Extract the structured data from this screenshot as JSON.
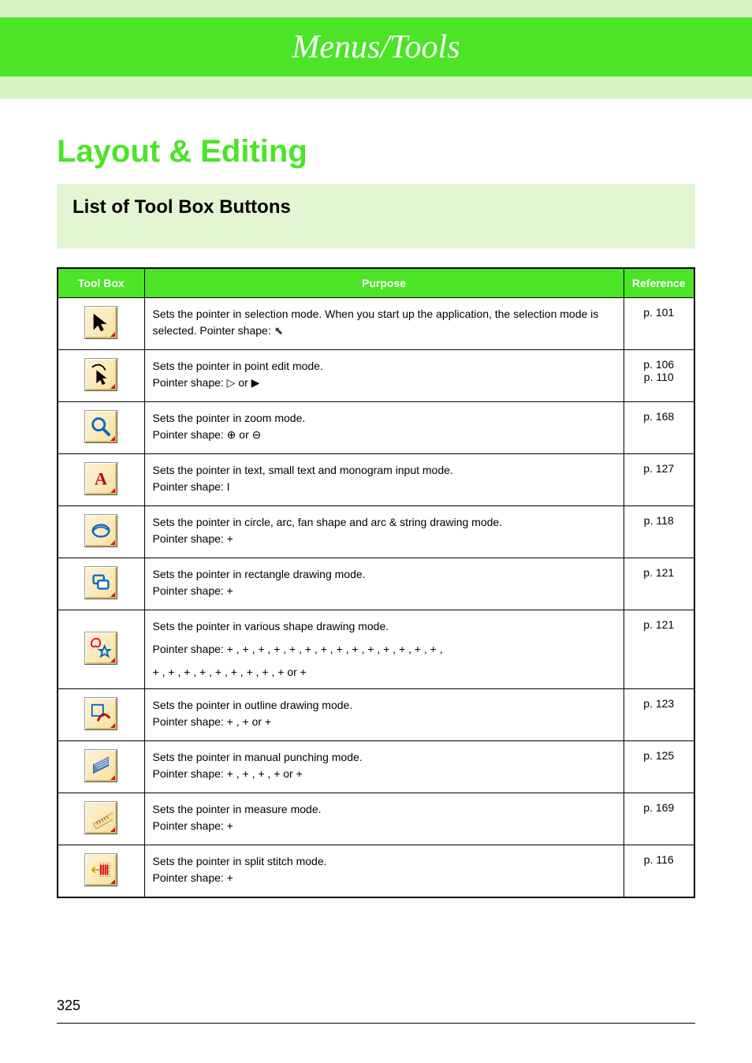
{
  "banner_title": "Menus/Tools",
  "section_title": "Layout & Editing",
  "subsection_title": "List of Tool Box Buttons",
  "table_headers": {
    "tool": "Tool Box",
    "purpose": "Purpose",
    "ref": "Reference"
  },
  "rows": [
    {
      "icon": "selection",
      "purpose_a": "Sets the pointer in selection mode. When you start up the application, the selection mode is selected. Pointer shape: ",
      "ref": "p. 101"
    },
    {
      "icon": "point-edit",
      "purpose_a": "Sets the pointer in point edit mode.",
      "purpose_b": "Pointer shape:  ▷  or  ▶",
      "ref": "p. 106\np. 110"
    },
    {
      "icon": "zoom",
      "purpose_a": "Sets the pointer in zoom mode.",
      "purpose_b": "Pointer shape:  ⊕  or  ⊖",
      "ref": "p. 168"
    },
    {
      "icon": "text",
      "purpose_a": "Sets the pointer in text, small text and monogram input mode.",
      "purpose_b": "Pointer shape:   I",
      "ref": "p. 127"
    },
    {
      "icon": "circle",
      "purpose_a": "Sets the pointer in circle, arc, fan shape and arc & string drawing mode.",
      "purpose_b": "Pointer shape:  +",
      "ref": "p. 118"
    },
    {
      "icon": "rect",
      "purpose_a": "Sets the pointer in rectangle drawing mode.",
      "purpose_b": "Pointer shape:  +",
      "ref": "p. 121"
    },
    {
      "icon": "shapes",
      "purpose_a": "Sets the pointer in various shape drawing mode.",
      "purpose_b": "Pointer shape:  + ,  + ,  + ,  + ,  + ,  + ,  + ,  + ,  + ,  + ,  + ,  + ,  + ,  + ,",
      "purpose_c": "+ ,  + ,  + ,  + ,  + ,  + ,  + ,  + ,  +  or  +",
      "ref": "p. 121"
    },
    {
      "icon": "outline",
      "purpose_a": "Sets the pointer in outline drawing mode.",
      "purpose_b": "Pointer shape:  + ,  +  or  +",
      "ref": "p. 123"
    },
    {
      "icon": "punch",
      "purpose_a": "Sets the pointer in manual punching mode.",
      "purpose_b": "Pointer shape:  + ,  + ,  + ,  +  or  +",
      "ref": "p. 125"
    },
    {
      "icon": "measure",
      "purpose_a": "Sets the pointer in measure mode.",
      "purpose_b": "Pointer shape:  +",
      "ref": "p. 169"
    },
    {
      "icon": "split",
      "purpose_a": "Sets the pointer in split stitch mode.",
      "purpose_b": "Pointer shape:  +",
      "ref": "p. 116"
    }
  ],
  "page_number": "325"
}
